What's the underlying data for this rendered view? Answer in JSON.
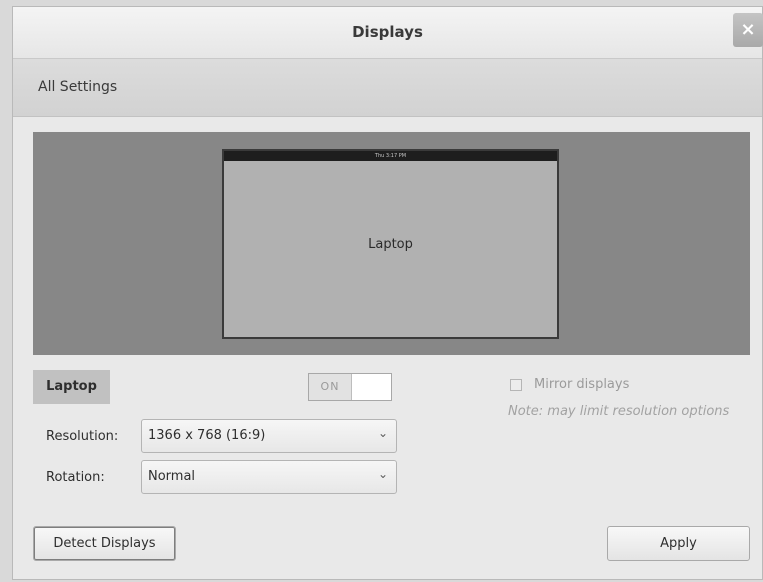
{
  "window": {
    "title": "Displays",
    "close_label": "×"
  },
  "toolbar": {
    "all_settings_label": "All Settings"
  },
  "preview": {
    "monitor_topbar_text": "Thu 3:17 PM",
    "monitor_label": "Laptop"
  },
  "display": {
    "name": "Laptop",
    "power_switch": "ON",
    "mirror_label": "Mirror displays",
    "mirror_checked": false,
    "mirror_note": "Note: may limit resolution options",
    "resolution_label": "Resolution:",
    "resolution_value": "1366 x 768 (16:9)",
    "rotation_label": "Rotation:",
    "rotation_value": "Normal"
  },
  "footer": {
    "detect_label": "Detect Displays",
    "apply_label": "Apply"
  },
  "icons": {
    "close": "close-icon",
    "dropdown": "chevron-down-icon",
    "checkbox": "checkbox-icon"
  }
}
